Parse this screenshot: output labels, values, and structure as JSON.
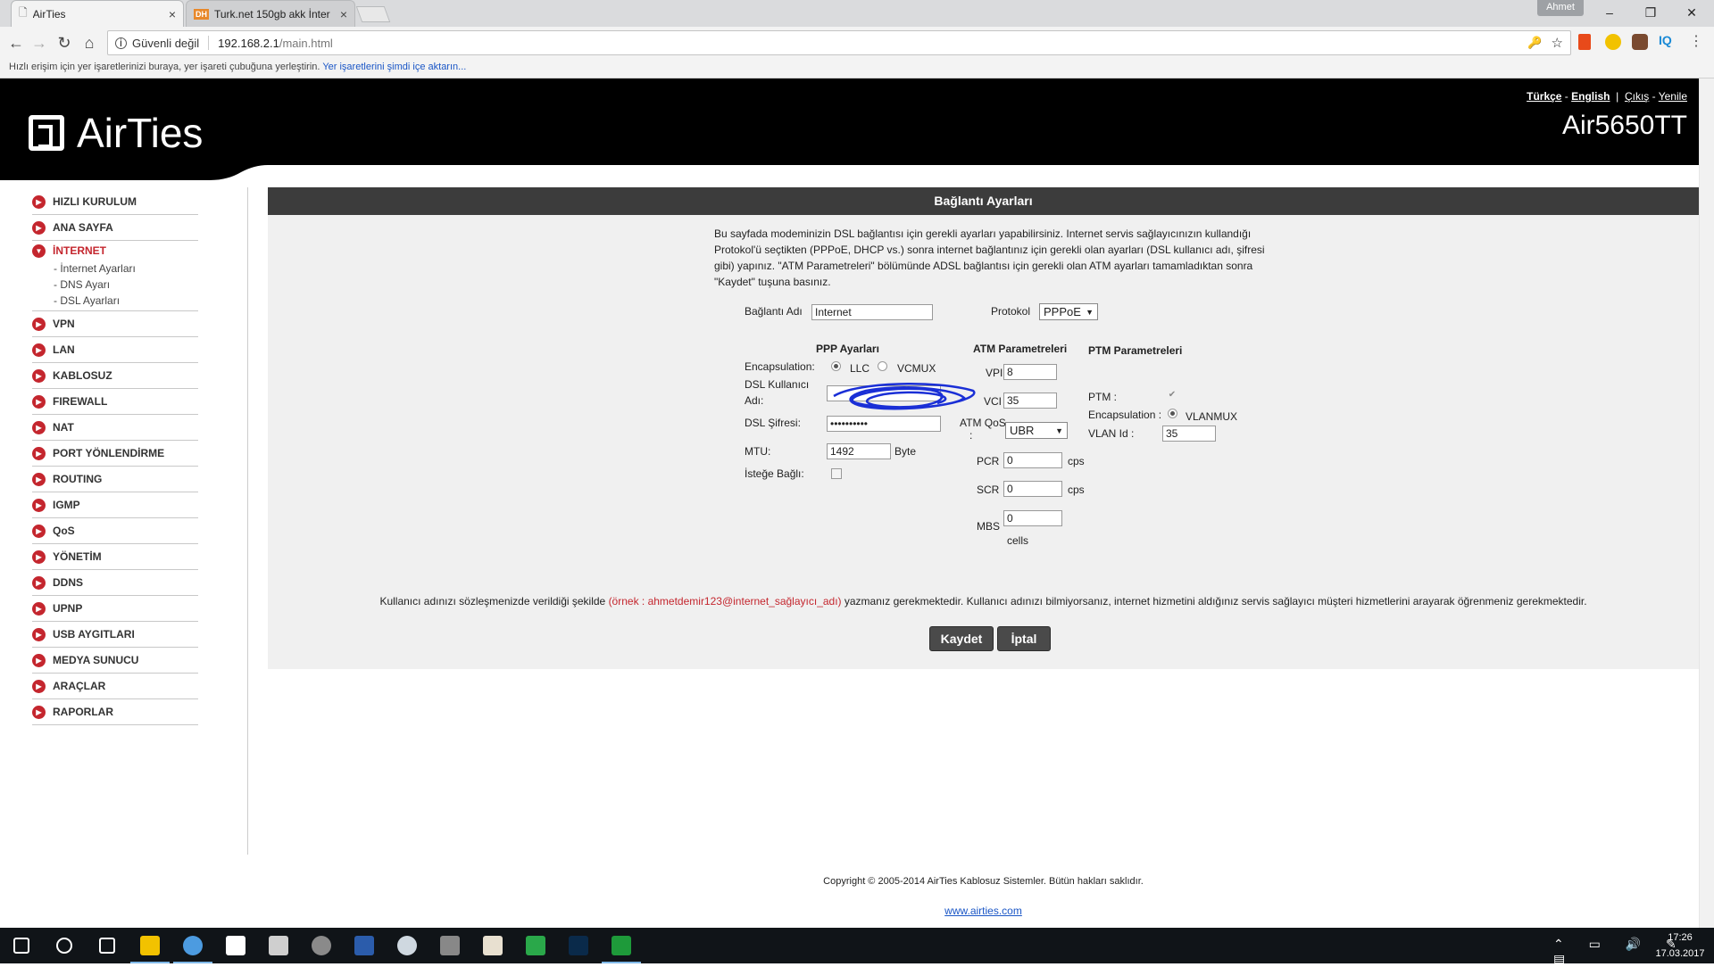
{
  "browser": {
    "tabs": [
      {
        "title": "AirTies",
        "close": "×"
      },
      {
        "title": "Turk.net 150gb akk İnter",
        "favicon": "DH",
        "close": "×"
      }
    ],
    "profile": "Ahmet",
    "window_controls": [
      "–",
      "❐",
      "✕"
    ],
    "security_label": "Güvenli değil",
    "url_host": "192.168.2.1",
    "url_path": "/main.html",
    "bookmarks_text": "Hızlı erişim için yer işaretlerinizi buraya, yer işareti çubuğuna yerleştirin.",
    "bookmarks_link": "Yer işaretlerini şimdi içe aktarın..."
  },
  "header": {
    "logo_text": "AirTies",
    "lang_tr": "Türkçe",
    "lang_sep1": " - ",
    "lang_en": "English",
    "lang_sep2": "  |  ",
    "logout": "Çıkış",
    "lang_sep3": " - ",
    "refresh": "Yenile",
    "model": "Air5650TT"
  },
  "sidebar": {
    "items": [
      {
        "label": "HIZLI KURULUM"
      },
      {
        "label": "ANA SAYFA"
      },
      {
        "label": "İNTERNET",
        "active": true,
        "subitems": [
          "- İnternet Ayarları",
          "- DNS Ayarı",
          "- DSL Ayarları"
        ]
      },
      {
        "label": "VPN"
      },
      {
        "label": "LAN"
      },
      {
        "label": "KABLOSUZ"
      },
      {
        "label": "FIREWALL"
      },
      {
        "label": "NAT"
      },
      {
        "label": "PORT YÖNLENDİRME"
      },
      {
        "label": "ROUTING"
      },
      {
        "label": "IGMP"
      },
      {
        "label": "QoS"
      },
      {
        "label": "YÖNETİM"
      },
      {
        "label": "DDNS"
      },
      {
        "label": "UPNP"
      },
      {
        "label": "USB AYGITLARI"
      },
      {
        "label": "MEDYA SUNUCU"
      },
      {
        "label": "ARAÇLAR"
      },
      {
        "label": "RAPORLAR"
      }
    ]
  },
  "content": {
    "title": "Bağlantı Ayarları",
    "intro": "Bu sayfada modeminizin DSL bağlantısı için gerekli ayarları yapabilirsiniz. Internet servis sağlayıcınızın kullandığı Protokol'ü seçtikten (PPPoE, DHCP vs.) sonra internet bağlantınız için gerekli olan ayarları (DSL kullanıcı adı, şifresi gibi) yapınız. \"ATM Parametreleri\" bölümünde ADSL bağlantısı için gerekli olan ATM ayarları tamamladıktan sonra \"Kaydet\" tuşuna basınız.",
    "connection_name_label": "Bağlantı Adı",
    "connection_name_value": "Internet",
    "protocol_label": "Protokol",
    "protocol_value": "PPPoE",
    "ppp": {
      "heading": "PPP Ayarları",
      "encapsulation_label": "Encapsulation:",
      "enc_llc": "LLC",
      "enc_vcmux": "VCMUX",
      "enc_selected": "LLC",
      "dsl_user_label_1": "DSL Kullanıcı",
      "dsl_user_label_2": "Adı:",
      "dsl_password_label": "DSL Şifresi:",
      "dsl_password_value": "••••••••••",
      "mtu_label": "MTU:",
      "mtu_value": "1492",
      "mtu_unit": "Byte",
      "on_demand_label": "İsteğe Bağlı:",
      "on_demand_checked": false
    },
    "atm": {
      "heading": "ATM Parametreleri",
      "vpi_label": "VPI",
      "vpi_value": "8",
      "vci_label": "VCI",
      "vci_value": "35",
      "qos_label_1": "ATM QoS",
      "qos_label_2": ":",
      "qos_value": "UBR",
      "pcr_label": "PCR",
      "pcr_value": "0",
      "pcr_unit": "cps",
      "scr_label": "SCR",
      "scr_value": "0",
      "scr_unit": "cps",
      "mbs_label": "MBS",
      "mbs_value": "0",
      "mbs_unit": "cells"
    },
    "ptm": {
      "heading": "PTM Parametreleri",
      "ptm_label": "PTM :",
      "ptm_checked": true,
      "encapsulation_label": "Encapsulation :",
      "enc_vlanmux": "VLANMUX",
      "vlan_label": "VLAN Id :",
      "vlan_value": "35"
    },
    "note_before": "Kullanıcı adınızı sözleşmenizde verildiği şekilde ",
    "note_example": "(örnek : ahmetdemir123@internet_sağlayıcı_adı)",
    "note_after": " yazmanız gerekmektedir. Kullanıcı adınızı bilmiyorsanız, internet hizmetini aldığınız servis sağlayıcı müşteri hizmetlerini arayarak öğrenmeniz gerekmektedir.",
    "save_button": "Kaydet",
    "cancel_button": "İptal"
  },
  "footer": {
    "copyright": "Copyright © 2005-2014 AirTies Kablosuz Sistemler. Bütün hakları saklıdır.",
    "website": "www.airties.com"
  },
  "taskbar": {
    "time": "17:26",
    "date": "17.03.2017",
    "apps": [
      "start-icon",
      "search-icon",
      "task-view-icon",
      "file-explorer-icon",
      "chrome-icon",
      "store-icon",
      "settings-icon",
      "app-icon",
      "word-icon",
      "steam-icon",
      "app-icon",
      "app-icon",
      "app-icon",
      "photoshop-icon",
      "camtasia-icon"
    ]
  },
  "colors": {
    "brand_red": "#c4262e",
    "header_bg": "#000000",
    "panel_head_bg": "#3c3c3c",
    "panel_bg": "#f0f0f0",
    "button_bg": "#4a4a4a",
    "link_blue": "#1a56c6",
    "scribble_blue": "#1a2fd6"
  }
}
